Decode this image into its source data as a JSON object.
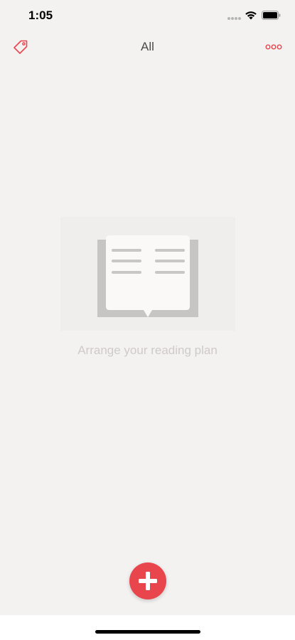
{
  "status_bar": {
    "time": "1:05"
  },
  "nav": {
    "title": "All",
    "left_icon": "tag-icon",
    "right_icon": "more-icon"
  },
  "empty_state": {
    "icon": "open-book-icon",
    "message": "Arrange your reading plan"
  },
  "fab": {
    "icon": "plus-icon"
  },
  "colors": {
    "accent": "#e8454d",
    "background": "#f4f2f1",
    "title_text": "#4a4a4a",
    "empty_text": "#cfcac8"
  }
}
